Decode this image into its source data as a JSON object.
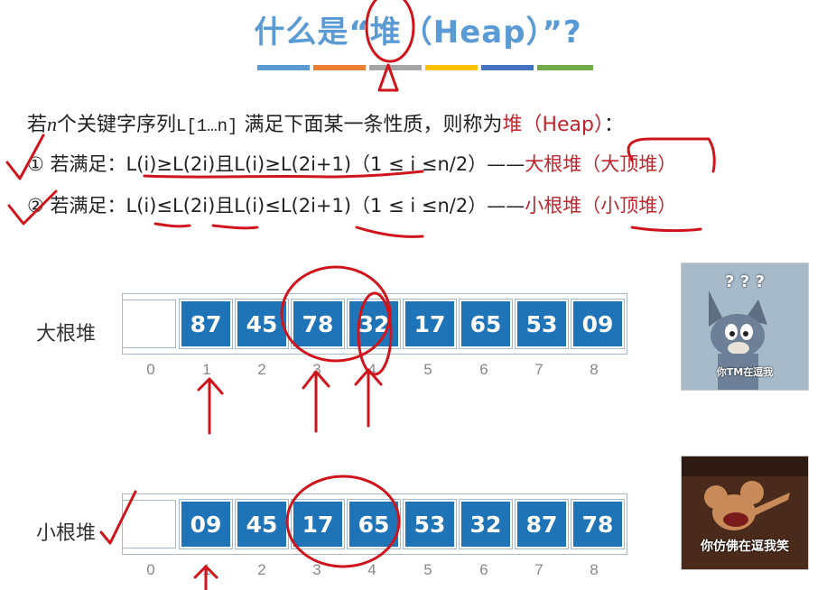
{
  "title": "什么是“堆（Heap）”?",
  "color_bar_colors": [
    "#5b9bd5",
    "#ed7d31",
    "#a5a5a5",
    "#ffc000",
    "#4472c4",
    "#70ad47"
  ],
  "definition": {
    "prefix": "若",
    "n": "n",
    "middle": "个关键字序列",
    "seq": "L[1…n]",
    "suffix": " 满足下面某一条性质，则称为",
    "heap_term": "堆（Heap）",
    "colon": "："
  },
  "rule1": {
    "num": "①",
    "text": " 若满足：L(i)≥L(2i)且L(i)≥L(2i+1)（1 ≤ i ≤n/2）——",
    "name": "大根堆（大顶堆）"
  },
  "rule2": {
    "num": "②",
    "text": " 若满足：L(i)≤L(2i)且L(i)≤L(2i+1)（1 ≤ i ≤n/2）——",
    "name": "小根堆（小顶堆）"
  },
  "max_heap": {
    "label": "大根堆",
    "values": [
      "87",
      "45",
      "78",
      "32",
      "17",
      "65",
      "53",
      "09"
    ]
  },
  "min_heap": {
    "label": "小根堆",
    "values": [
      "09",
      "45",
      "17",
      "65",
      "53",
      "32",
      "87",
      "78"
    ]
  },
  "indices": [
    "0",
    "1",
    "2",
    "3",
    "4",
    "5",
    "6",
    "7",
    "8"
  ],
  "meme1": {
    "marks": "? ? ?",
    "caption": "你TM在逗我"
  },
  "meme2": {
    "caption": "你仿佛在逗我笑"
  },
  "colors": {
    "title": "#5b9bd5",
    "cell": "#1f73b7",
    "accent_red": "#c0262d",
    "ink": "#d0141b"
  }
}
